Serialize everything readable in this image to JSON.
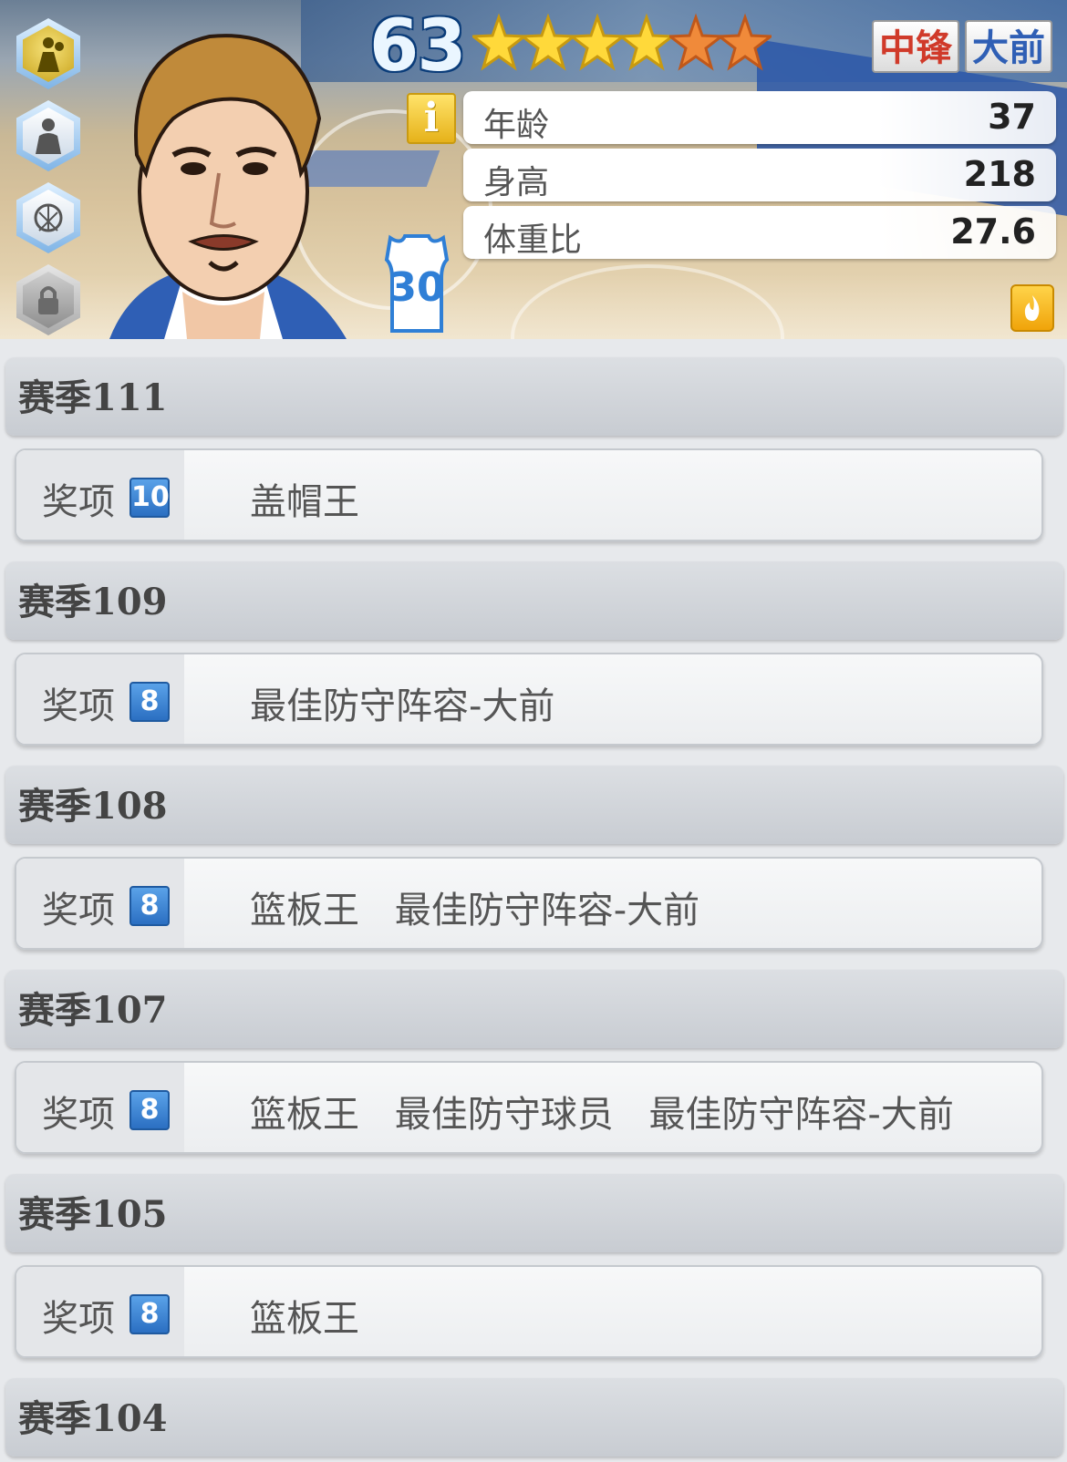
{
  "player": {
    "rating": "63",
    "stars_total": 6,
    "stars_gold": 4,
    "positions": [
      {
        "label": "中锋",
        "color": "#d03a2a"
      },
      {
        "label": "大前",
        "color": "#2f5fb5"
      }
    ],
    "jersey_number": "30",
    "info_label": "i",
    "stats": [
      {
        "label": "年龄",
        "value": "37"
      },
      {
        "label": "身高",
        "value": "218"
      },
      {
        "label": "体重比",
        "value": "27.6"
      }
    ]
  },
  "side_icons": [
    "player-icon",
    "silhouette-icon",
    "basketball-hoop-icon",
    "lock-icon"
  ],
  "seasons": [
    {
      "title": "赛季111",
      "award_label": "奖项",
      "award_count": "10",
      "awards": [
        "盖帽王"
      ]
    },
    {
      "title": "赛季109",
      "award_label": "奖项",
      "award_count": "8",
      "awards": [
        "最佳防守阵容-大前"
      ]
    },
    {
      "title": "赛季108",
      "award_label": "奖项",
      "award_count": "8",
      "awards": [
        "篮板王",
        "最佳防守阵容-大前"
      ]
    },
    {
      "title": "赛季107",
      "award_label": "奖项",
      "award_count": "8",
      "awards": [
        "篮板王",
        "最佳防守球员",
        "最佳防守阵容-大前"
      ]
    },
    {
      "title": "赛季105",
      "award_label": "奖项",
      "award_count": "8",
      "awards": [
        "篮板王"
      ]
    },
    {
      "title": "赛季104"
    }
  ]
}
